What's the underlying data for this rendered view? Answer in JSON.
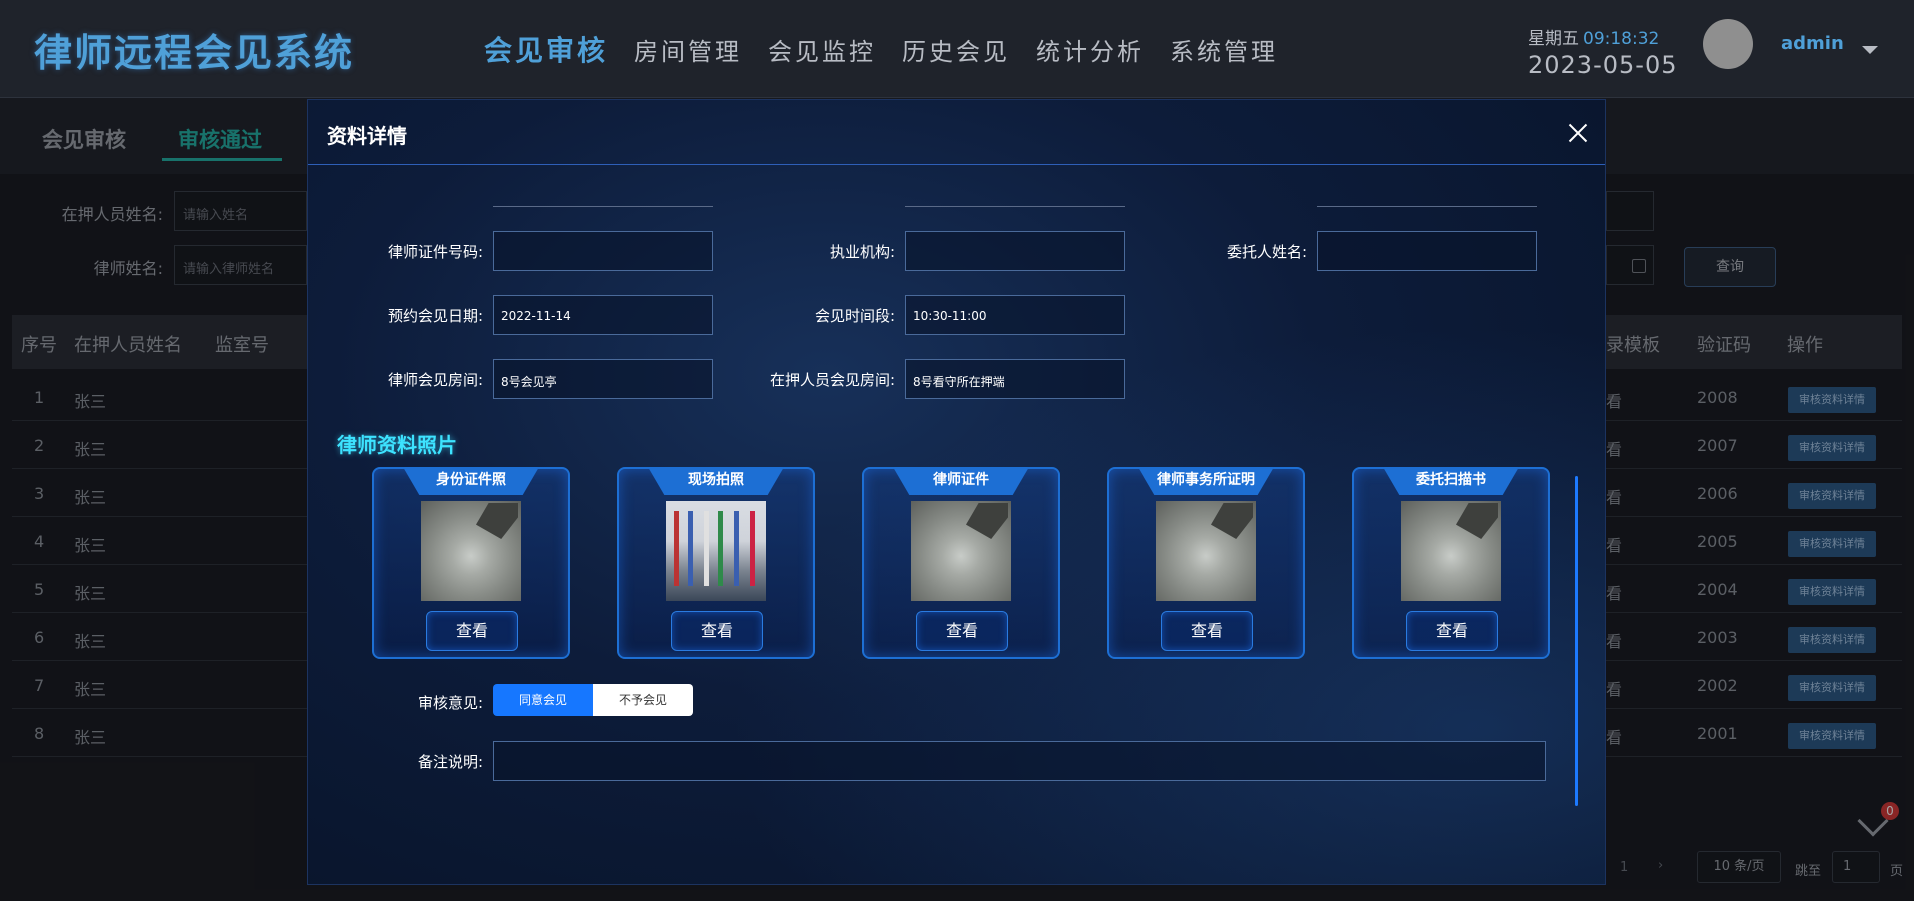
{
  "header": {
    "app_title": "律师远程会见系统",
    "nav": [
      "会见审核",
      "房间管理",
      "会见监控",
      "历史会见",
      "统计分析",
      "系统管理"
    ],
    "weekday": "星期五",
    "time": "09:18:32",
    "date": "2023-05-05",
    "username": "admin"
  },
  "page": {
    "subtabs": [
      "会见审核",
      "审核通过"
    ],
    "filters": {
      "detainee_label": "在押人员姓名:",
      "detainee_placeholder": "请输入姓名",
      "lawyer_label": "律师姓名:",
      "lawyer_placeholder": "请输入律师姓名",
      "query_button": "查询"
    },
    "table": {
      "headers_left": [
        "序号",
        "在押人员姓名",
        "监室号"
      ],
      "headers_right": [
        "录模板",
        "验证码",
        "操作"
      ],
      "rows": [
        {
          "no": "1",
          "name": "张三",
          "fragment": "看",
          "code": "2008",
          "action": "审核资料详情"
        },
        {
          "no": "2",
          "name": "张三",
          "fragment": "看",
          "code": "2007",
          "action": "审核资料详情"
        },
        {
          "no": "3",
          "name": "张三",
          "fragment": "看",
          "code": "2006",
          "action": "审核资料详情"
        },
        {
          "no": "4",
          "name": "张三",
          "fragment": "看",
          "code": "2005",
          "action": "审核资料详情"
        },
        {
          "no": "5",
          "name": "张三",
          "fragment": "看",
          "code": "2004",
          "action": "审核资料详情"
        },
        {
          "no": "6",
          "name": "张三",
          "fragment": "看",
          "code": "2003",
          "action": "审核资料详情"
        },
        {
          "no": "7",
          "name": "张三",
          "fragment": "看",
          "code": "2002",
          "action": "审核资料详情"
        },
        {
          "no": "8",
          "name": "张三",
          "fragment": "看",
          "code": "2001",
          "action": "审核资料详情"
        }
      ]
    },
    "pager": {
      "page": "1",
      "next": "›",
      "page_size": "10 条/页",
      "jump_label": "跳至",
      "jump_value": "1",
      "page_unit": "页"
    },
    "notification_count": "0"
  },
  "modal": {
    "title": "资料详情",
    "fields": {
      "license_no_label": "律师证件号码:",
      "license_no_value": "",
      "firm_label": "执业机构:",
      "firm_value": "",
      "client_label": "委托人姓名:",
      "client_value": "",
      "date_label": "预约会见日期:",
      "date_value": "2022-11-14",
      "slot_label": "会见时间段:",
      "slot_value": "10:30-11:00",
      "lawyer_room_label": "律师会见房间:",
      "lawyer_room_value": "8号会见亭",
      "detainee_room_label": "在押人员会见房间:",
      "detainee_room_value": "8号看守所在押端"
    },
    "photo_section_title": "律师资料照片",
    "photos": [
      {
        "title": "身份证件照",
        "button": "查看"
      },
      {
        "title": "现场拍照",
        "button": "查看"
      },
      {
        "title": "律师证件",
        "button": "查看"
      },
      {
        "title": "律师事务所证明",
        "button": "查看"
      },
      {
        "title": "委托扫描书",
        "button": "查看"
      }
    ],
    "opinion_label": "审核意见:",
    "opinion_options": [
      "同意会见",
      "不予会见"
    ],
    "opinion_selected": "同意会见",
    "remark_label": "备注说明:",
    "remark_value": ""
  },
  "colors": {
    "accent": "#4fa0d8",
    "teal": "#26b0a5",
    "card_border": "#1d6fd4",
    "primary_button": "#1677ff",
    "section_title": "#3de3ff"
  }
}
